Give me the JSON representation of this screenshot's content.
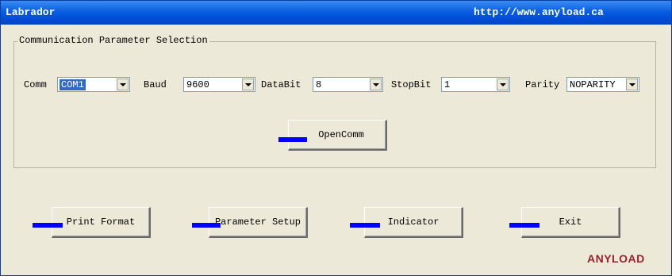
{
  "window": {
    "title": "Labrador",
    "url": "http://www.anyload.ca"
  },
  "group": {
    "legend": "Communication Parameter Selection"
  },
  "params": {
    "comm": {
      "label": "Comm",
      "value": "COM1"
    },
    "baud": {
      "label": "Baud",
      "value": "9600"
    },
    "databit": {
      "label": "DataBit",
      "value": "8"
    },
    "stopbit": {
      "label": "StopBit",
      "value": "1"
    },
    "parity": {
      "label": "Parity",
      "value": "NOPARITY"
    }
  },
  "buttons": {
    "open_comm": "OpenComm",
    "print_format": "Print Format",
    "parameter_setup": "Parameter Setup",
    "indicator": "Indicator",
    "exit": "Exit"
  },
  "logo": "ANYLOAD",
  "colors": {
    "titlebar": "#0050d8",
    "marker": "#0000ff",
    "logo": "#9b2030",
    "window_bg": "#ece9d8"
  }
}
